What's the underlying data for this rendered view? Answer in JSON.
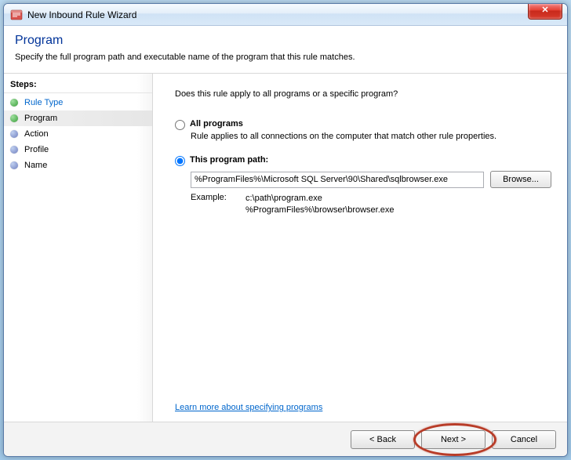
{
  "window": {
    "title": "New Inbound Rule Wizard"
  },
  "header": {
    "title": "Program",
    "subtitle": "Specify the full program path and executable name of the program that this rule matches."
  },
  "sidebar": {
    "steps_label": "Steps:",
    "items": [
      {
        "label": "Rule Type",
        "state": "done"
      },
      {
        "label": "Program",
        "state": "active"
      },
      {
        "label": "Action",
        "state": "pending"
      },
      {
        "label": "Profile",
        "state": "pending"
      },
      {
        "label": "Name",
        "state": "pending"
      }
    ]
  },
  "content": {
    "question": "Does this rule apply to all programs or a specific program?",
    "options": {
      "all": {
        "title": "All programs",
        "desc": "Rule applies to all connections on the computer that match other rule properties."
      },
      "path": {
        "title": "This program path:",
        "value": "%ProgramFiles%\\Microsoft SQL Server\\90\\Shared\\sqlbrowser.exe",
        "browse": "Browse..."
      },
      "selected": "path"
    },
    "example": {
      "label": "Example:",
      "line1": "c:\\path\\program.exe",
      "line2": "%ProgramFiles%\\browser\\browser.exe"
    },
    "learn_more": "Learn more about specifying programs"
  },
  "buttons": {
    "back": "< Back",
    "next": "Next >",
    "cancel": "Cancel"
  }
}
